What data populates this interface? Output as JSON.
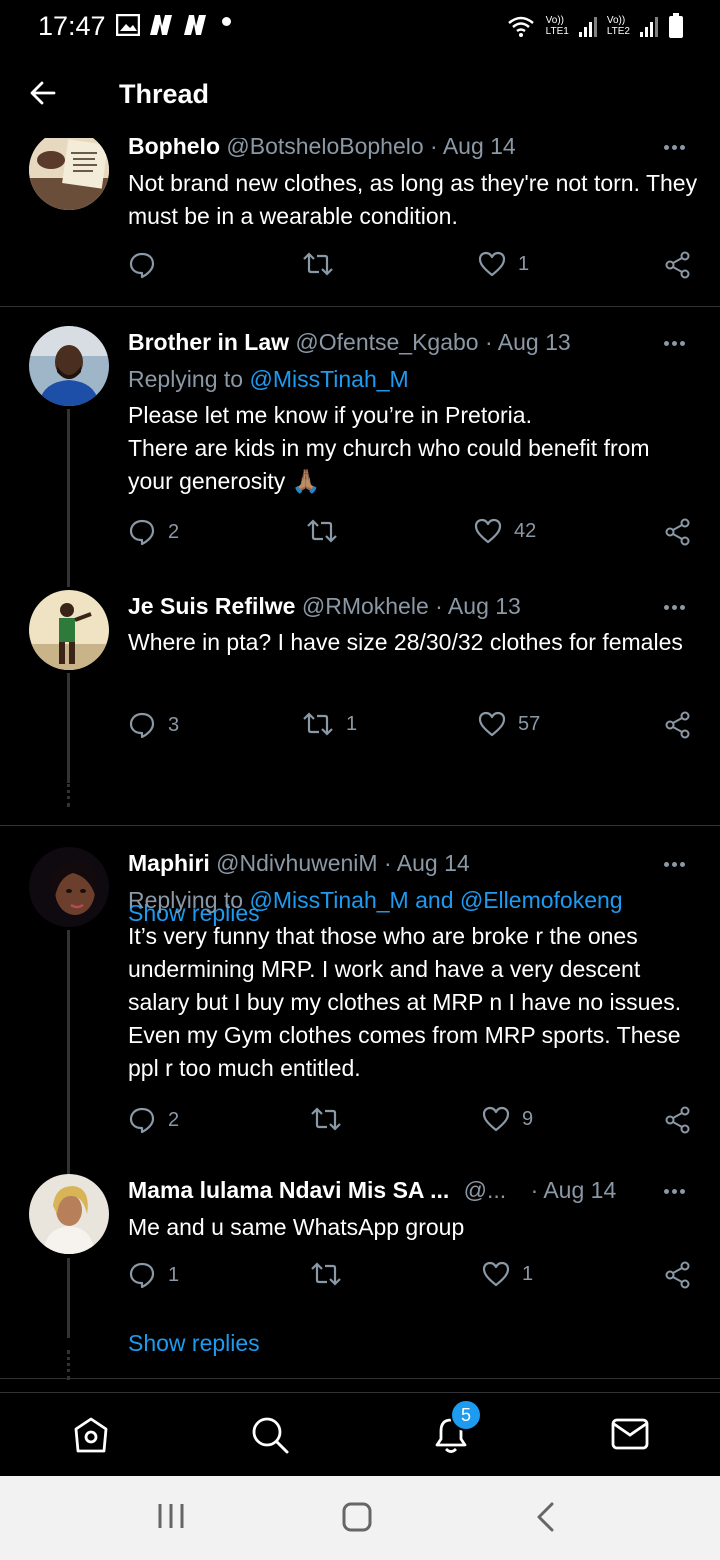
{
  "status_bar": {
    "time": "17:47",
    "sim1": "LTE1",
    "sim2": "LTE2",
    "volte": "Vo))"
  },
  "header": {
    "title": "Thread"
  },
  "tweets": [
    {
      "name": "Bophelo",
      "handle": "@BotsheloBophelo",
      "date": "· Aug 14",
      "text": "Not brand new clothes, as long as they're not torn. They must be in a wearable condition.",
      "replies": "",
      "retweets": "",
      "likes": "1"
    },
    {
      "name": "Brother in Law",
      "handle": "@Ofentse_Kgabo",
      "date": "· Aug 13",
      "replying_label": "Replying to",
      "replying_to": "@MissTinah_M",
      "text": "Please let me know if you’re in Pretoria.\nThere are kids in my church who could benefit from your generosity 🙏🏽",
      "replies": "2",
      "retweets": "",
      "likes": "42"
    },
    {
      "name": "Je Suis Refilwe",
      "handle": "@RMokhele",
      "date": "· Aug 13",
      "text": "Where in pta? I have size 28/30/32  clothes for females",
      "replies": "3",
      "retweets": "1",
      "likes": "57"
    },
    {
      "name": "Maphiri",
      "handle": "@NdivhuweniM",
      "date": "· Aug 14",
      "replying_label": "Replying to",
      "replying_to": "@MissTinah_M and @Ellemofokeng",
      "text": "It’s very funny that those who are broke r the ones undermining MRP. I work and have a very descent salary but I buy my clothes at MRP n I have no issues. Even my Gym clothes comes from MRP sports. These ppl r too much entitled.",
      "replies": "2",
      "retweets": "",
      "likes": "9"
    },
    {
      "name": "Mama lulama Ndavi Mis SA ...",
      "handle": "@...",
      "date": "· Aug 14",
      "text": "Me and u same WhatsApp group",
      "replies": "1",
      "retweets": "",
      "likes": "1"
    }
  ],
  "show_replies_label": "Show replies",
  "tabs": [
    {
      "icon": "home-icon"
    },
    {
      "icon": "search-icon"
    },
    {
      "icon": "notifications-icon",
      "badge": "5"
    },
    {
      "icon": "messages-icon"
    }
  ],
  "colors": {
    "background": "#000000",
    "accent": "#1d9bf0",
    "secondary_text": "#8b98a5"
  }
}
